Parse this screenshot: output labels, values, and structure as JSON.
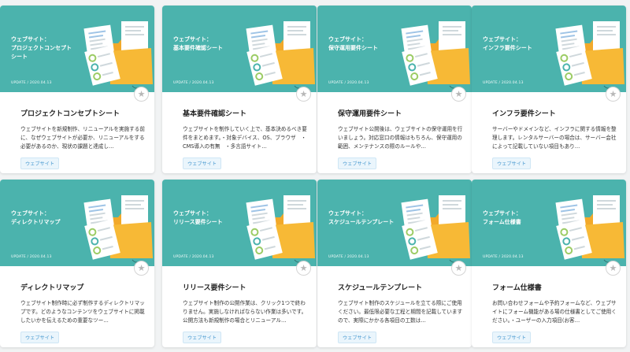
{
  "cards": [
    {
      "thumb_title": "ウェブサイト：\nプロジェクトコンセプト\nシート",
      "update": "UPDATE / 2020.04.13",
      "title": "プロジェクトコンセプトシート",
      "description": "ウェブサイトを新規制作、リニューアルを実施する前に、なぜウェブサイトが必要か、リニューアルをする必要があるのか、現状の課題と達成し…",
      "tag": "ウェブサイト"
    },
    {
      "thumb_title": "ウェブサイト：\n基本要件確認シート",
      "update": "UPDATE / 2020.04.13",
      "title": "基本要件確認シート",
      "description": "ウェブサイトを制作していく上で、基本決めるべき要件をまとめます。・対象デバイス、OS、ブラウザ　・CMS導入の有無　・多言語サイト…",
      "tag": "ウェブサイト"
    },
    {
      "thumb_title": "ウェブサイト：\n保守運用要件シート",
      "update": "UPDATE / 2020.04.13",
      "title": "保守運用要件シート",
      "description": "ウェブサイト公開後は、ウェブサイトの保守運用を行いましょう。対応窓口の情報はもちろん、保守運用の範囲、メンテナンスの際のルールや…",
      "tag": "ウェブサイト"
    },
    {
      "thumb_title": "ウェブサイト：\nインフラ要件シート",
      "update": "UPDATE / 2020.04.13",
      "title": "インフラ要件シート",
      "description": "サーバーやドメインなど、インフラに関する情報を整理します。レンタルサーバーの場合は、サーバー会社によって記載していない項目もあり…",
      "tag": "ウェブサイト"
    },
    {
      "thumb_title": "ウェブサイト：\nディレクトリマップ",
      "update": "UPDATE / 2020.04.13",
      "title": "ディレクトリマップ",
      "description": "ウェブサイト制作時に必ず制作するディレクトリマップです。どのようなコンテンツをウェブサイトに掲載したいかを伝えるための重要なツー…",
      "tag": "ウェブサイト"
    },
    {
      "thumb_title": "ウェブサイト：\nリリース要件シート",
      "update": "UPDATE / 2020.04.13",
      "title": "リリース要件シート",
      "description": "ウェブサイト制作の公開作業は、クリック1つで終わりません。実施しなければならない作業は多いです。公開方法も新規制作の場合とリニューアル…",
      "tag": "ウェブサイト"
    },
    {
      "thumb_title": "ウェブサイト：\nスケジュールテンプレート",
      "update": "UPDATE / 2020.04.13",
      "title": "スケジュールテンプレート",
      "description": "ウェブサイト制作のスケジュールを立てる際にご使用ください。最低限必要な工程と期間を記載していますので、実際にかかる各項目の工数は…",
      "tag": "ウェブサイト"
    },
    {
      "thumb_title": "ウェブサイト：\nフォーム仕様書",
      "update": "UPDATE / 2020.04.13",
      "title": "フォーム仕様書",
      "description": "お問い合わせフォームや予約フォームなど、ウェブサイトにフォーム機能がある場の仕様書としてご使用ください。・ユーザーの入力項目(お客…",
      "tag": "ウェブサイト"
    }
  ],
  "colors": {
    "thumb_bg": "#4bb3ad",
    "folder": "#f7b936",
    "tag_text": "#4a9ad0"
  },
  "icons": {
    "favorite": "star-icon"
  }
}
